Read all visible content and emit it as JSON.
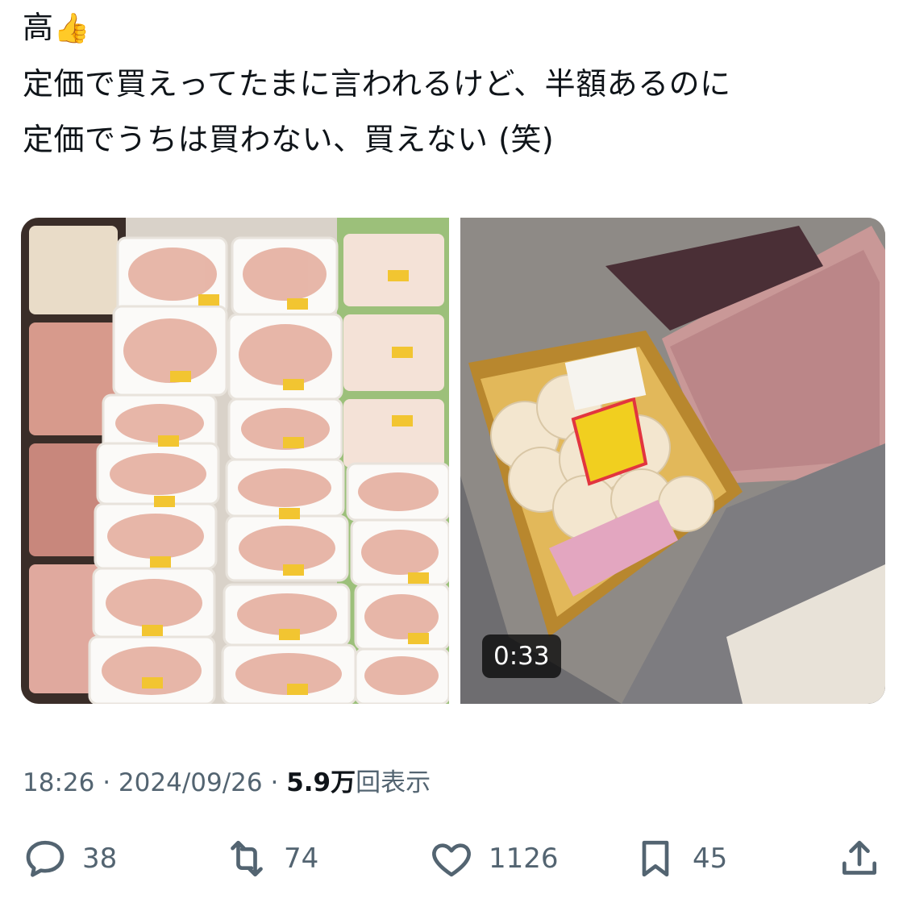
{
  "tweet": {
    "lines": [
      "高",
      "定価で買えってたまに言われるけど、半額あるのに",
      "定価でうちは買わない、買えない (笑)"
    ],
    "emoji": "👍"
  },
  "media": {
    "left_alt_icon": "photo",
    "right_alt_icon": "video",
    "video_duration": "0:33"
  },
  "meta": {
    "time": "18:26",
    "separator": "·",
    "date": "2024/09/26",
    "views_count": "5.9万",
    "views_label": "回表示"
  },
  "actions": {
    "replies": "38",
    "reposts": "74",
    "likes": "1126",
    "bookmarks": "45"
  },
  "colors": {
    "text": "#0f1419",
    "secondary": "#536471",
    "background": "#ffffff"
  }
}
